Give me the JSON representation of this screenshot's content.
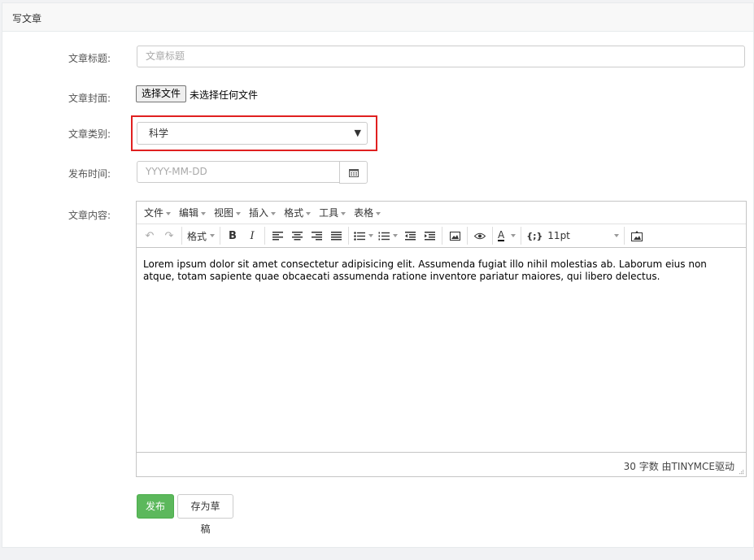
{
  "panel": {
    "title": "写文章"
  },
  "form": {
    "title_label": "文章标题:",
    "title_placeholder": "文章标题",
    "cover_label": "文章封面:",
    "cover_button": "选择文件",
    "cover_status": "未选择任何文件",
    "category_label": "文章类别:",
    "category_value": "科学",
    "date_label": "发布时间:",
    "date_placeholder": "YYYY-MM-DD",
    "content_label": "文章内容:"
  },
  "editor": {
    "menus": [
      "文件",
      "编辑",
      "视图",
      "插入",
      "格式",
      "工具",
      "表格"
    ],
    "format_label": "格式",
    "fontsize": "11pt",
    "text": "Lorem ipsum dolor sit amet consectetur adipisicing elit. Assumenda fugiat illo nihil molestias ab. Laborum eius non atque, totam sapiente quae obcaecati assumenda ratione inventore pariatur maiores, qui libero delectus.",
    "status": "30 字数 由TINYMCE驱动"
  },
  "actions": {
    "publish": "发布",
    "draft": "存为草稿"
  },
  "colors": {
    "accent_red": "#e02020",
    "publish_green": "#5cb85c"
  }
}
